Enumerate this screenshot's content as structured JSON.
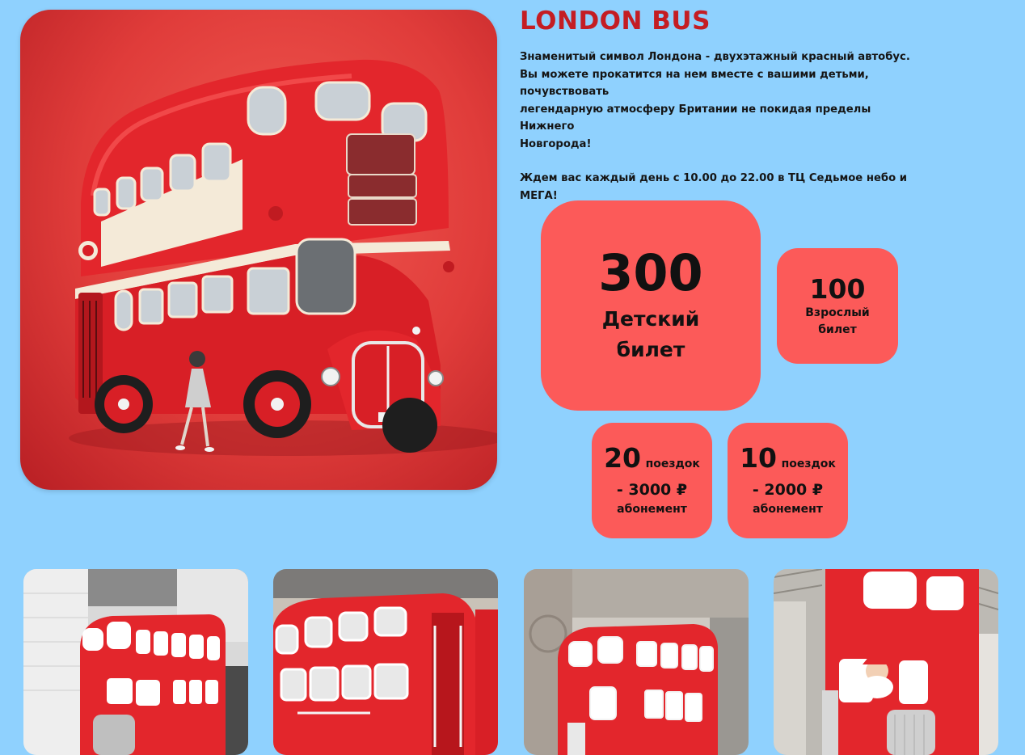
{
  "title": "LONDON BUS",
  "description": {
    "lines": [
      "Знаменитый символ Лондона - двухэтажный красный автобус.",
      "Вы можете прокатится на нем вместе с вашими детьми, почувствовать",
      "легендарную атмосферу Британии не покидая пределы Нижнего",
      "Новгорода!"
    ],
    "schedule_lines": [
      "Ждем вас каждый день с 10.00 до 22.00 в ТЦ Седьмое небо и",
      "МЕГА!"
    ]
  },
  "prices": {
    "child": {
      "value": "300",
      "label_line1": "Детский",
      "label_line2": "билет"
    },
    "adult": {
      "value": "100",
      "label_line1": "Взрослый",
      "label_line2": "билет"
    }
  },
  "passes": [
    {
      "count": "20",
      "unit": "поездок",
      "price": "- 3000 ₽",
      "label": "абонемент"
    },
    {
      "count": "10",
      "unit": "поездок",
      "price": "- 2000 ₽",
      "label": "абонемент"
    }
  ],
  "colors": {
    "background": "#8fd1fe",
    "title": "#c41d23",
    "card": "#fc5a59",
    "bus_red": "#e3262c"
  },
  "hero_image": {
    "icon": "red-double-decker-bus-illustration"
  },
  "gallery": [
    {
      "icon": "bus-photo-mall"
    },
    {
      "icon": "bus-photo-closeup"
    },
    {
      "icon": "bus-photo-front"
    },
    {
      "icon": "bus-photo-santa"
    }
  ]
}
